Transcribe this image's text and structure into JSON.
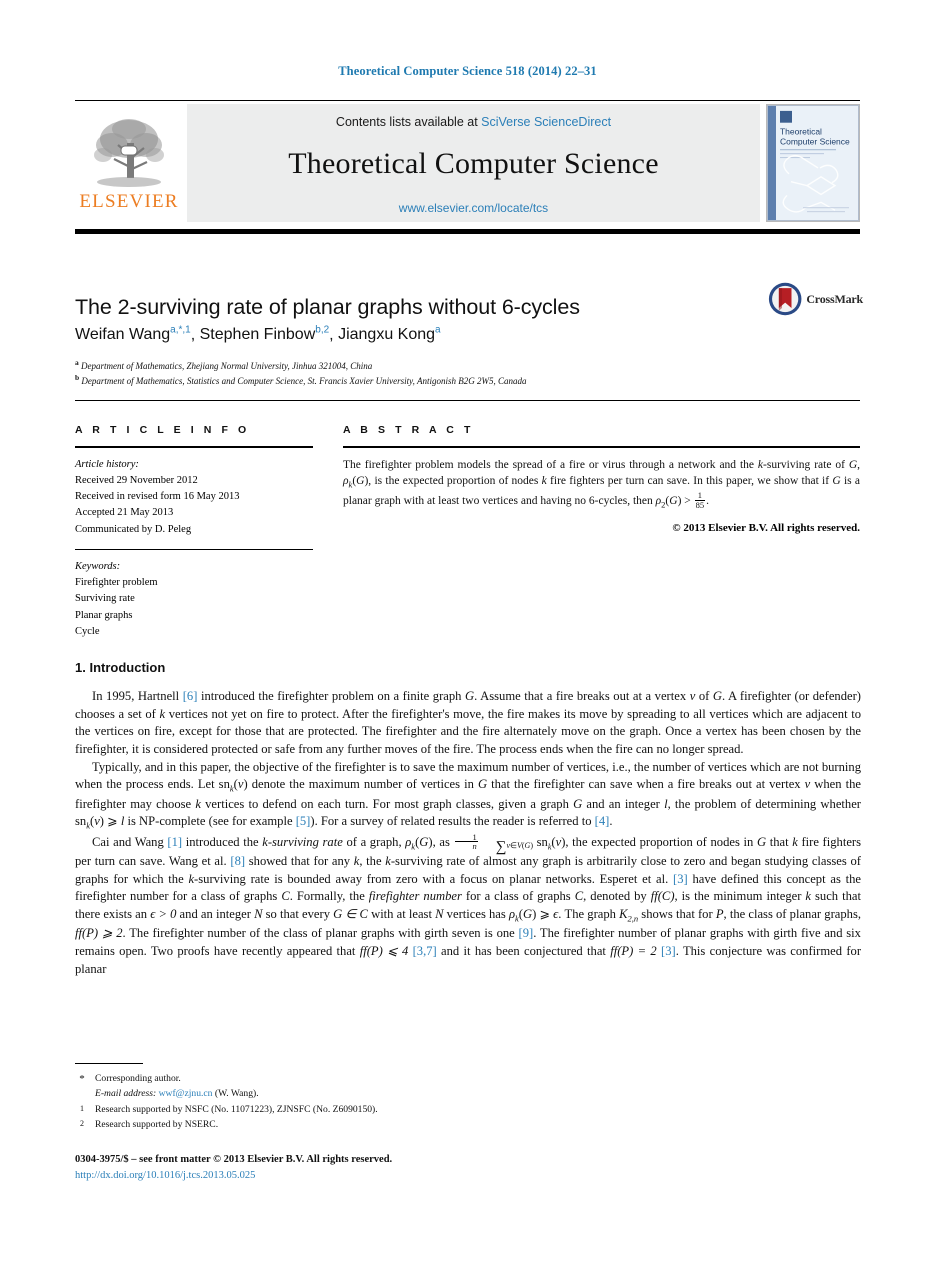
{
  "running_head": "Theoretical Computer Science 518 (2014) 22–31",
  "masthead": {
    "publisher_name": "ELSEVIER",
    "contents_prefix": "Contents lists available at ",
    "contents_link": "SciVerse ScienceDirect",
    "journal_name": "Theoretical Computer Science",
    "journal_url": "www.elsevier.com/locate/tcs",
    "cover_title_line1": "Theoretical",
    "cover_title_line2": "Computer Science"
  },
  "article": {
    "title": "The 2-surviving rate of planar graphs without 6-cycles",
    "authors": [
      {
        "name": "Weifan Wang",
        "marks": "a,*,1"
      },
      {
        "name": "Stephen Finbow",
        "marks": "b,2"
      },
      {
        "name": "Jiangxu Kong",
        "marks": "a"
      }
    ],
    "affiliations": [
      {
        "mark": "a",
        "text": "Department of Mathematics, Zhejiang Normal University, Jinhua 321004, China"
      },
      {
        "mark": "b",
        "text": "Department of Mathematics, Statistics and Computer Science, St. Francis Xavier University, Antigonish B2G 2W5, Canada"
      }
    ],
    "crossmark_label": "CrossMark"
  },
  "info": {
    "heading": "A R T I C L E    I N F O",
    "history_title": "Article history:",
    "history": [
      "Received 29 November 2012",
      "Received in revised form 16 May 2013",
      "Accepted 21 May 2013",
      "Communicated by D. Peleg"
    ],
    "keywords_title": "Keywords:",
    "keywords": [
      "Firefighter problem",
      "Surviving rate",
      "Planar graphs",
      "Cycle"
    ]
  },
  "abstract": {
    "heading": "A B S T R A C T",
    "part1": "The firefighter problem models the spread of a fire or virus through a network and the ",
    "sym_k1": "k",
    "part2": "-surviving rate of ",
    "sym_G1": "G",
    "part3": ", ",
    "rho_k": "ρ",
    "rho_k_sub": "k",
    "part4": "(",
    "sym_G2": "G",
    "part5": "), is the expected proportion of nodes ",
    "sym_k2": "k",
    "part6": " fire fighters per turn can save. In this paper, we show that if ",
    "sym_G3": "G",
    "part7": " is a planar graph with at least two vertices and having no 6-cycles, then ",
    "rho2": "ρ",
    "rho2_sub": "2",
    "part8": "(",
    "sym_G4": "G",
    "part9": ") > ",
    "frac_num": "1",
    "frac_den": "85",
    "part10": ".",
    "copyright": "© 2013 Elsevier B.V. All rights reserved."
  },
  "body": {
    "section_number_title": "1. Introduction",
    "paragraphs": [
      {
        "id": "p1",
        "runs": [
          {
            "t": "In 1995, Hartnell "
          },
          {
            "t": "[6]",
            "k": "ref"
          },
          {
            "t": " introduced the firefighter problem on a finite graph "
          },
          {
            "t": "G",
            "k": "math"
          },
          {
            "t": ". Assume that a fire breaks out at a vertex "
          },
          {
            "t": "v",
            "k": "math"
          },
          {
            "t": " of "
          },
          {
            "t": "G",
            "k": "math"
          },
          {
            "t": ". A firefighter (or defender) chooses a set of "
          },
          {
            "t": "k",
            "k": "math"
          },
          {
            "t": " vertices not yet on fire to protect. After the firefighter's move, the fire makes its move by spreading to all vertices which are adjacent to the vertices on fire, except for those that are protected. The firefighter and the fire alternately move on the graph. Once a vertex has been chosen by the firefighter, it is considered protected or safe from any further moves of the fire. The process ends when the fire can no longer spread."
          }
        ]
      },
      {
        "id": "p2",
        "runs": [
          {
            "t": "Typically, and in this paper, the objective of the firefighter is to save the maximum number of vertices, i.e., the number of vertices which are not burning when the process ends. Let sn"
          },
          {
            "t": "k",
            "k": "sub-math"
          },
          {
            "t": "("
          },
          {
            "t": "v",
            "k": "math"
          },
          {
            "t": ") denote the maximum number of vertices in "
          },
          {
            "t": "G",
            "k": "math"
          },
          {
            "t": " that the firefighter can save when a fire breaks out at vertex "
          },
          {
            "t": "v",
            "k": "math"
          },
          {
            "t": " when the firefighter may choose "
          },
          {
            "t": "k",
            "k": "math"
          },
          {
            "t": " vertices to defend on each turn. For most graph classes, given a graph "
          },
          {
            "t": "G",
            "k": "math"
          },
          {
            "t": " and an integer "
          },
          {
            "t": "l",
            "k": "math"
          },
          {
            "t": ", the problem of determining whether sn"
          },
          {
            "t": "k",
            "k": "sub-math"
          },
          {
            "t": "("
          },
          {
            "t": "v",
            "k": "math"
          },
          {
            "t": ") ⩾ "
          },
          {
            "t": "l",
            "k": "math"
          },
          {
            "t": " is NP-complete (see for example "
          },
          {
            "t": "[5]",
            "k": "ref"
          },
          {
            "t": "). For a survey of related results the reader is referred to "
          },
          {
            "t": "[4]",
            "k": "ref"
          },
          {
            "t": "."
          }
        ]
      },
      {
        "id": "p3",
        "runs": [
          {
            "t": "Cai and Wang "
          },
          {
            "t": "[1]",
            "k": "ref"
          },
          {
            "t": " introduced the "
          },
          {
            "t": "k-surviving rate",
            "k": "ital"
          },
          {
            "t": " of a graph, "
          },
          {
            "t": "ρ",
            "k": "math"
          },
          {
            "t": "k",
            "k": "sub-math"
          },
          {
            "t": "("
          },
          {
            "t": "G",
            "k": "math"
          },
          {
            "t": "), as "
          },
          {
            "t": "FRAC_SUM",
            "k": "formula"
          },
          {
            "t": ", the expected proportion of nodes in "
          },
          {
            "t": "G",
            "k": "math"
          },
          {
            "t": " that "
          },
          {
            "t": "k",
            "k": "math"
          },
          {
            "t": " fire fighters per turn can save. Wang et al. "
          },
          {
            "t": "[8]",
            "k": "ref"
          },
          {
            "t": " showed that for any "
          },
          {
            "t": "k",
            "k": "math"
          },
          {
            "t": ", the "
          },
          {
            "t": "k",
            "k": "math"
          },
          {
            "t": "-surviving rate of almost any graph is arbitrarily close to zero and began studying classes of graphs for which the "
          },
          {
            "t": "k",
            "k": "math"
          },
          {
            "t": "-surviving rate is bounded away from zero with a focus on planar networks. Esperet et al. "
          },
          {
            "t": "[3]",
            "k": "ref"
          },
          {
            "t": " have defined this concept as the firefighter number for a class of graphs "
          },
          {
            "t": "C",
            "k": "cal"
          },
          {
            "t": ". Formally, the "
          },
          {
            "t": "firefighter number",
            "k": "ital"
          },
          {
            "t": " for a class of graphs "
          },
          {
            "t": "C",
            "k": "cal"
          },
          {
            "t": ", denoted by "
          },
          {
            "t": "ff(C)",
            "k": "math"
          },
          {
            "t": ", is the minimum integer "
          },
          {
            "t": "k",
            "k": "math"
          },
          {
            "t": " such that there exists an "
          },
          {
            "t": "ϵ > 0",
            "k": "math"
          },
          {
            "t": " and an integer "
          },
          {
            "t": "N",
            "k": "math"
          },
          {
            "t": " so that every "
          },
          {
            "t": "G ∈ C",
            "k": "math"
          },
          {
            "t": " with at least "
          },
          {
            "t": "N",
            "k": "math"
          },
          {
            "t": " vertices has "
          },
          {
            "t": "ρ",
            "k": "math"
          },
          {
            "t": "k",
            "k": "sub-math"
          },
          {
            "t": "("
          },
          {
            "t": "G",
            "k": "math"
          },
          {
            "t": ") ⩾ "
          },
          {
            "t": "ϵ",
            "k": "math"
          },
          {
            "t": ". The graph "
          },
          {
            "t": "K",
            "k": "math"
          },
          {
            "t": "2,n",
            "k": "sub-math"
          },
          {
            "t": " shows that for "
          },
          {
            "t": "P",
            "k": "cal"
          },
          {
            "t": ", the class of planar graphs, "
          },
          {
            "t": "ff(P) ⩾ 2",
            "k": "math"
          },
          {
            "t": ". The firefighter number of the class of planar graphs with girth seven is one "
          },
          {
            "t": "[9]",
            "k": "ref"
          },
          {
            "t": ". The firefighter number of planar graphs with girth five and six remains open. Two proofs have recently appeared that "
          },
          {
            "t": "ff(P) ⩽ 4",
            "k": "math"
          },
          {
            "t": " "
          },
          {
            "t": "[3,7]",
            "k": "ref"
          },
          {
            "t": " and it has been conjectured that "
          },
          {
            "t": "ff(P) = 2",
            "k": "math"
          },
          {
            "t": " "
          },
          {
            "t": "[3]",
            "k": "ref"
          },
          {
            "t": ". This conjecture was confirmed for planar"
          }
        ]
      }
    ]
  },
  "footnotes": {
    "corresponding": "Corresponding author.",
    "email_label": "E-mail address:",
    "email": "wwf@zjnu.cn",
    "email_owner": "(W. Wang).",
    "note1_mark": "1",
    "note1": "Research supported by NSFC (No. 11071223), ZJNSFC (No. Z6090150).",
    "note2_mark": "2",
    "note2": "Research supported by NSERC.",
    "star_mark": "*"
  },
  "issn": {
    "line": "0304-3975/$ – see front matter  © 2013 Elsevier B.V. All rights reserved.",
    "doi": "http://dx.doi.org/10.1016/j.tcs.2013.05.025"
  },
  "colors": {
    "link": "#2b7fb8",
    "elsevier_orange": "#ec7d22",
    "band_grey": "#eceded"
  }
}
